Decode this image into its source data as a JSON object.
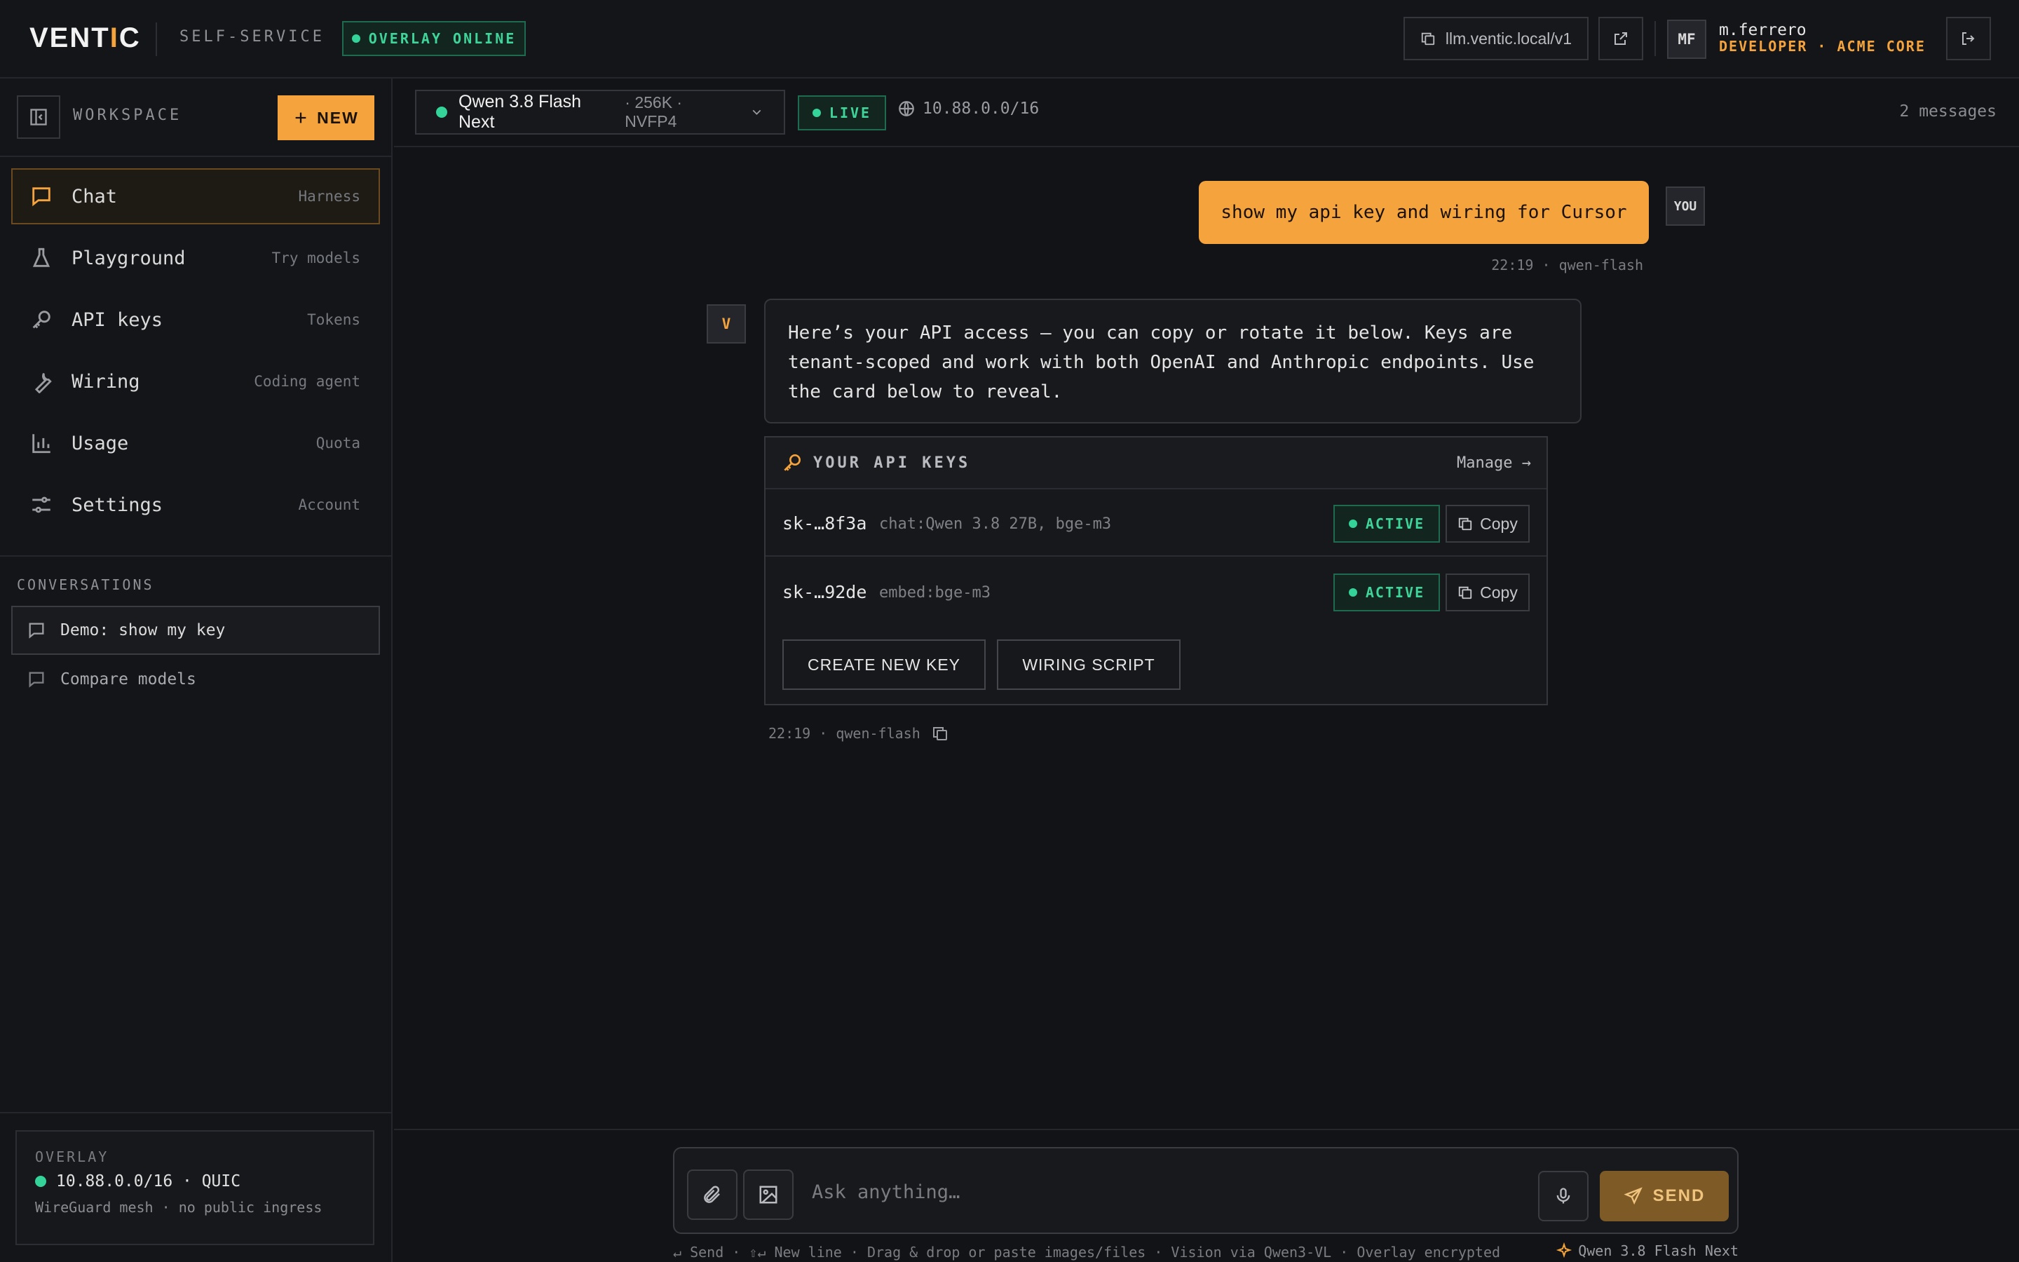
{
  "header": {
    "logo_main": "VENT",
    "logo_accent": "I",
    "logo_tail": "C",
    "self_service": "SELF-SERVICE",
    "overlay_status": "OVERLAY ONLINE",
    "endpoint": "llm.ventic.local/v1",
    "user_initials": "MF",
    "user_name": "m.ferrero",
    "user_role": "DEVELOPER · ACME CORE"
  },
  "sidebar": {
    "workspace_label": "WORKSPACE",
    "new_label": "NEW",
    "nav": [
      {
        "label": "Chat",
        "sub": "Harness",
        "icon": "chat-bubble-icon"
      },
      {
        "label": "Playground",
        "sub": "Try models",
        "icon": "flask-icon"
      },
      {
        "label": "API keys",
        "sub": "Tokens",
        "icon": "key-icon"
      },
      {
        "label": "Wiring",
        "sub": "Coding agent",
        "icon": "wrench-icon"
      },
      {
        "label": "Usage",
        "sub": "Quota",
        "icon": "bar-chart-icon"
      },
      {
        "label": "Settings",
        "sub": "Account",
        "icon": "sliders-icon"
      }
    ],
    "conversations_label": "CONVERSATIONS",
    "conversations": [
      {
        "label": "Demo: show my key"
      },
      {
        "label": "Compare models"
      }
    ],
    "overlay": {
      "title": "OVERLAY",
      "line": "10.88.0.0/16 · QUIC",
      "sub": "WireGuard mesh · no public ingress"
    }
  },
  "model_bar": {
    "model_name": "Qwen 3.8 Flash Next",
    "model_meta": "· 256K · NVFP4",
    "live_label": "LIVE",
    "subnet": "10.88.0.0/16",
    "message_count": "2 messages"
  },
  "messages": {
    "user_text": "show my api key and wiring for Cursor",
    "user_badge": "YOU",
    "user_meta": "22:19 · qwen-flash",
    "assistant_badge": "V",
    "assistant_text": "Here’s your API access — you can copy or rotate it below. Keys are tenant-scoped and work with both OpenAI and Anthropic endpoints. Use the card below to reveal.",
    "assistant_meta": "22:19 · qwen-flash"
  },
  "keys_card": {
    "title": "YOUR API KEYS",
    "manage": "Manage →",
    "keys": [
      {
        "id": "sk-…8f3a",
        "scope": "chat:Qwen 3.8 27B, bge-m3",
        "status": "ACTIVE",
        "copy": "Copy"
      },
      {
        "id": "sk-…92de",
        "scope": "embed:bge-m3",
        "status": "ACTIVE",
        "copy": "Copy"
      }
    ],
    "create_label": "CREATE NEW KEY",
    "wiring_label": "WIRING SCRIPT"
  },
  "composer": {
    "placeholder": "Ask anything…",
    "send_label": "SEND",
    "hint": "↵ Send · ⇧↵ New line · Drag & drop or paste images/files · Vision via Qwen3-VL · Overlay encrypted",
    "hint_model": "Qwen 3.8 Flash Next"
  },
  "colors": {
    "accent": "#f5a33c",
    "online": "#34d399",
    "background": "#121316"
  }
}
